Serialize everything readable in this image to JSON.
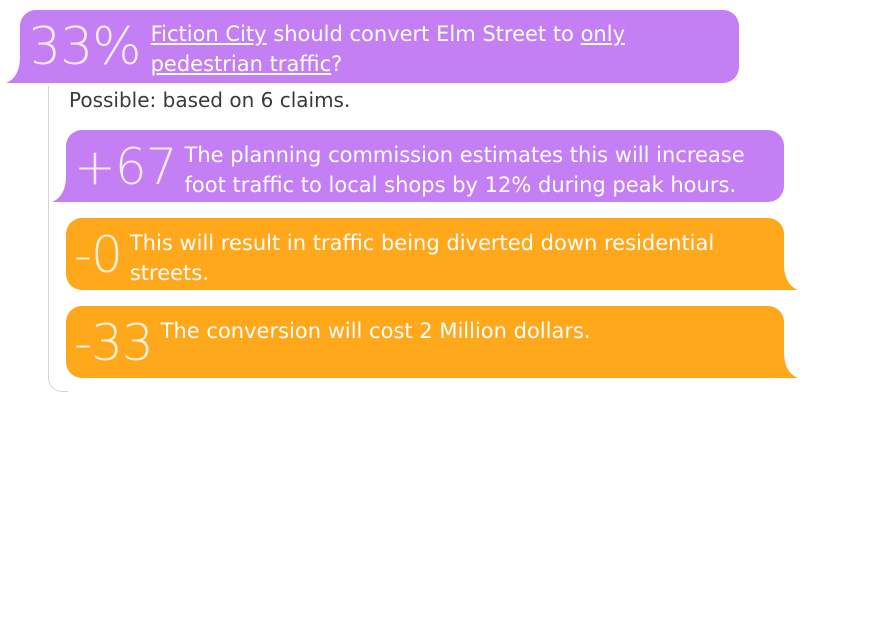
{
  "main_claim": {
    "score": "33%",
    "text_parts": [
      {
        "text": "Fiction City",
        "underline": true
      },
      {
        "text": " should convert Elm Street to ",
        "underline": false
      },
      {
        "text": "only pedestrian traffic",
        "underline": true
      },
      {
        "text": "?",
        "underline": false
      }
    ],
    "color": "#c47ff4"
  },
  "summary": "Possible: based on 6 claims.",
  "reasons": [
    {
      "score": "+67",
      "text": "The planning commission estimates this will increase foot traffic to local shops by 12% during peak hours.",
      "stance": "pro",
      "color": "#c47ff4"
    },
    {
      "score": "-0",
      "text": "This will result in traffic being diverted down residential streets.",
      "stance": "con",
      "color": "#ffa81c"
    },
    {
      "score": "-33",
      "text": "The conversion will cost 2 Million dollars.",
      "stance": "con",
      "color": "#ffa81c"
    }
  ]
}
